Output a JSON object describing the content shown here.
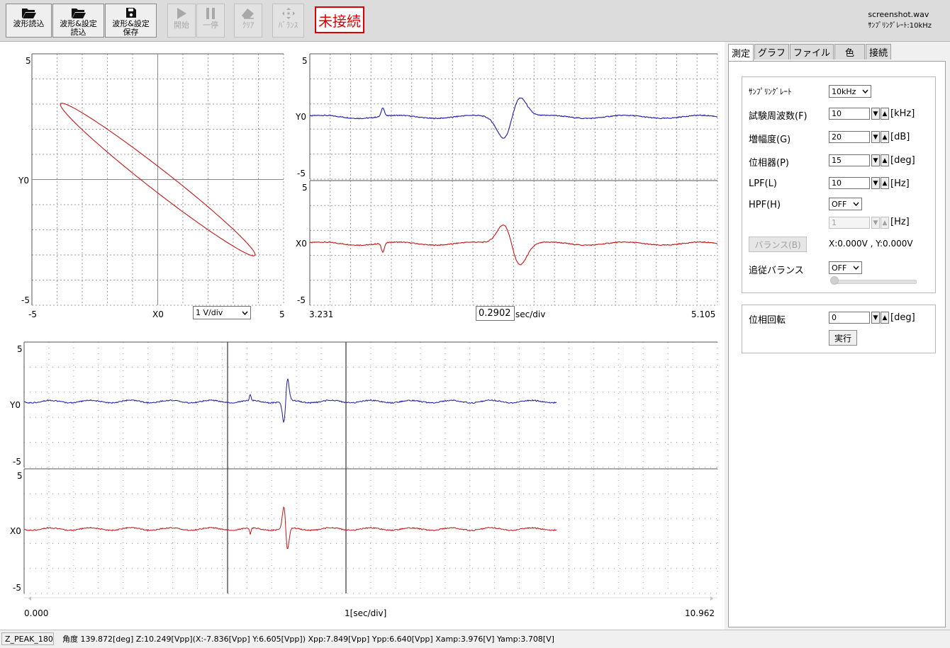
{
  "toolbar": {
    "buttons": [
      {
        "label": "波形読込",
        "icon": "folder-open-icon",
        "enabled": true
      },
      {
        "label": "波形&設定\n読込",
        "icon": "folder-open-icon",
        "enabled": true
      },
      {
        "label": "波形&設定\n保存",
        "icon": "floppy-disk-icon",
        "enabled": true
      },
      {
        "label": "開始",
        "icon": "play-icon",
        "enabled": false
      },
      {
        "label": "一停",
        "icon": "pause-icon",
        "enabled": false
      },
      {
        "label": "ｸﾘｱ",
        "icon": "eraser-icon",
        "enabled": false
      },
      {
        "label": "ﾊﾞﾗﾝｽ",
        "icon": "balance-icon",
        "enabled": false
      }
    ],
    "connection_status": "未接続",
    "file_name": "screenshot.wav",
    "sampling_info": "ｻﾝﾌﾟﾘﾝｸﾞﾚｰﾄ:10kHz"
  },
  "colors": {
    "y_trace": "#1a1aa8",
    "x_trace": "#c81414",
    "grid": "#9a9a9a",
    "status_red": "#dd0000"
  },
  "xy_plot": {
    "y_top": "5",
    "y_mid": "Y0",
    "y_bottom": "-5",
    "x_left": "-5",
    "x_mid": "X0",
    "x_right": "5",
    "scale": "1 V/div"
  },
  "time_plot": {
    "y_top": "5",
    "y_label": "Y0",
    "y_bottom": "-5",
    "x_top": "5",
    "x_label": "X0",
    "x_bottom": "-5",
    "t_start": "3.231",
    "t_end": "5.105",
    "time_div": "0.2902",
    "time_div_unit": "sec/div"
  },
  "overview_plot": {
    "y_top": "5",
    "y_label": "Y0",
    "y_bottom": "-5",
    "x_top": "5",
    "x_label": "X0",
    "x_bottom": "-5",
    "t_start": "0.000",
    "t_end": "10.962",
    "scale": "1[sec/div]"
  },
  "tabs": [
    "測定",
    "グラフ",
    "ファイル",
    "色",
    "接続"
  ],
  "settings": {
    "sampling_rate_label": "ｻﾝﾌﾟﾘﾝｸﾞﾚｰﾄ",
    "sampling_rate_value": "10kHz",
    "freq_label": "試験周波数(F)",
    "freq_value": "10",
    "freq_unit": "[kHz]",
    "gain_label": "増幅度(G)",
    "gain_value": "20",
    "gain_unit": "[dB]",
    "phase_label": "位相器(P)",
    "phase_value": "15",
    "phase_unit": "[deg]",
    "lpf_label": "LPF(L)",
    "lpf_value": "10",
    "lpf_unit": "[Hz]",
    "hpf_label": "HPF(H)",
    "hpf_value": "OFF",
    "hpf_num": "1",
    "hpf_unit": "[Hz]",
    "balance_button": "バランス(B)",
    "balance_readout": "X:0.000V , Y:0.000V",
    "track_label": "追従バランス",
    "track_value": "OFF",
    "rotation_label": "位相回転",
    "rotation_value": "0",
    "rotation_unit": "[deg]",
    "execute_button": "実行"
  },
  "status": {
    "mode": "Z_PEAK_180",
    "info": "角度  139.872[deg] Z:10.249[Vpp](X:-7.836[Vpp]  Y:6.605[Vpp])  Xpp:7.849[Vpp]  Ypp:6.640[Vpp]  Xamp:3.976[V]  Yamp:3.708[V]"
  }
}
